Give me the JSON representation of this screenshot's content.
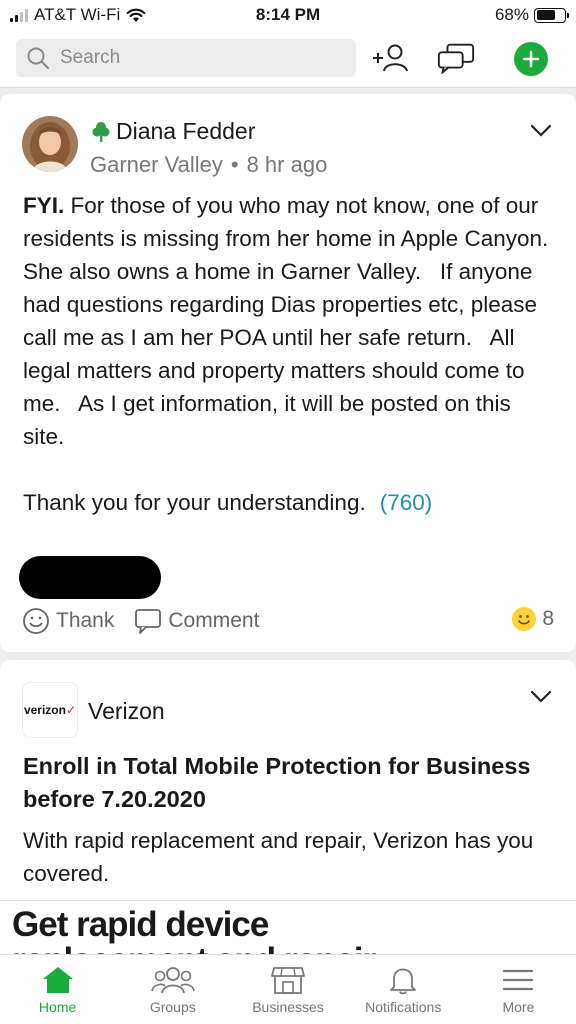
{
  "status_bar": {
    "carrier": "AT&T Wi-Fi",
    "time": "8:14 PM",
    "battery": "68%",
    "battery_level": 0.68
  },
  "header": {
    "search_placeholder": "Search"
  },
  "post": {
    "author": "Diana Fedder",
    "neighborhood": "Garner Valley",
    "separator": "•",
    "time": "8 hr ago",
    "lead": "FYI.",
    "body": " For those of you who may not know, one of our residents is missing from her home in Apple Canyon.  She also owns a home in Garner Valley.   If anyone had questions regarding Dias properties etc, please call me as I am her POA until her safe return.   All legal matters and property matters should come to me.   As I get information, it will be posted on this site.",
    "closing": "Thank you for your understanding.",
    "phone": "(760)",
    "thank_label": "Thank",
    "comment_label": "Comment",
    "reaction_count": "8"
  },
  "ad": {
    "logo_text": "verizon",
    "brand": "Verizon",
    "title": "Enroll in Total Mobile Protection for Business before 7.20.2020",
    "description": "With rapid replacement and repair, Verizon has you covered.",
    "banner_line1": "Get rapid device",
    "banner_line2": "replacement and repair"
  },
  "tabs": [
    {
      "label": "Home"
    },
    {
      "label": "Groups"
    },
    {
      "label": "Businesses"
    },
    {
      "label": "Notifications"
    },
    {
      "label": "More"
    }
  ],
  "colors": {
    "accent": "#1bab3d",
    "link": "#1f8fb0",
    "verizon_check": "#d52b1e"
  }
}
